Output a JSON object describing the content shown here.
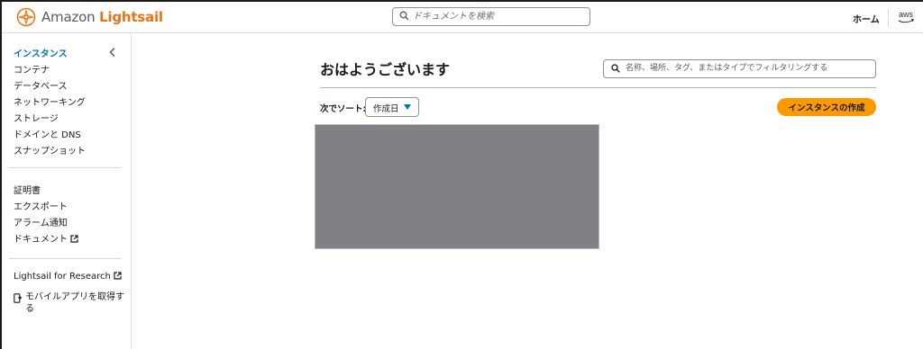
{
  "header": {
    "brand_prefix": "Amazon",
    "brand_name": "Lightsail",
    "doc_search_placeholder": "ドキュメントを検索",
    "home_label": "ホーム",
    "aws_logo_text": "aws"
  },
  "sidebar": {
    "primary_items": [
      {
        "label": "インスタンス",
        "active": true
      },
      {
        "label": "コンテナ"
      },
      {
        "label": "データベース"
      },
      {
        "label": "ネットワーキング"
      },
      {
        "label": "ストレージ"
      },
      {
        "label": "ドメインと DNS"
      },
      {
        "label": "スナップショット"
      }
    ],
    "secondary_items": [
      {
        "label": "証明書"
      },
      {
        "label": "エクスポート"
      },
      {
        "label": "アラーム通知"
      },
      {
        "label": "ドキュメント",
        "external": true
      }
    ],
    "research_link": "Lightsail for Research",
    "mobile_app_line1": "モバイルアプリを取得す",
    "mobile_app_line2": "る"
  },
  "main": {
    "title": "おはようございます",
    "filter_placeholder": "名称、場所、タグ、またはタイプでフィルタリングする",
    "sort_label": "次でソート:",
    "sort_value": "作成日",
    "create_button": "インスタンスの作成"
  },
  "colors": {
    "accent_orange": "#ff9900",
    "brand_orange": "#ec7211",
    "active_blue": "#0073bb",
    "placeholder_gray": "#808186"
  }
}
